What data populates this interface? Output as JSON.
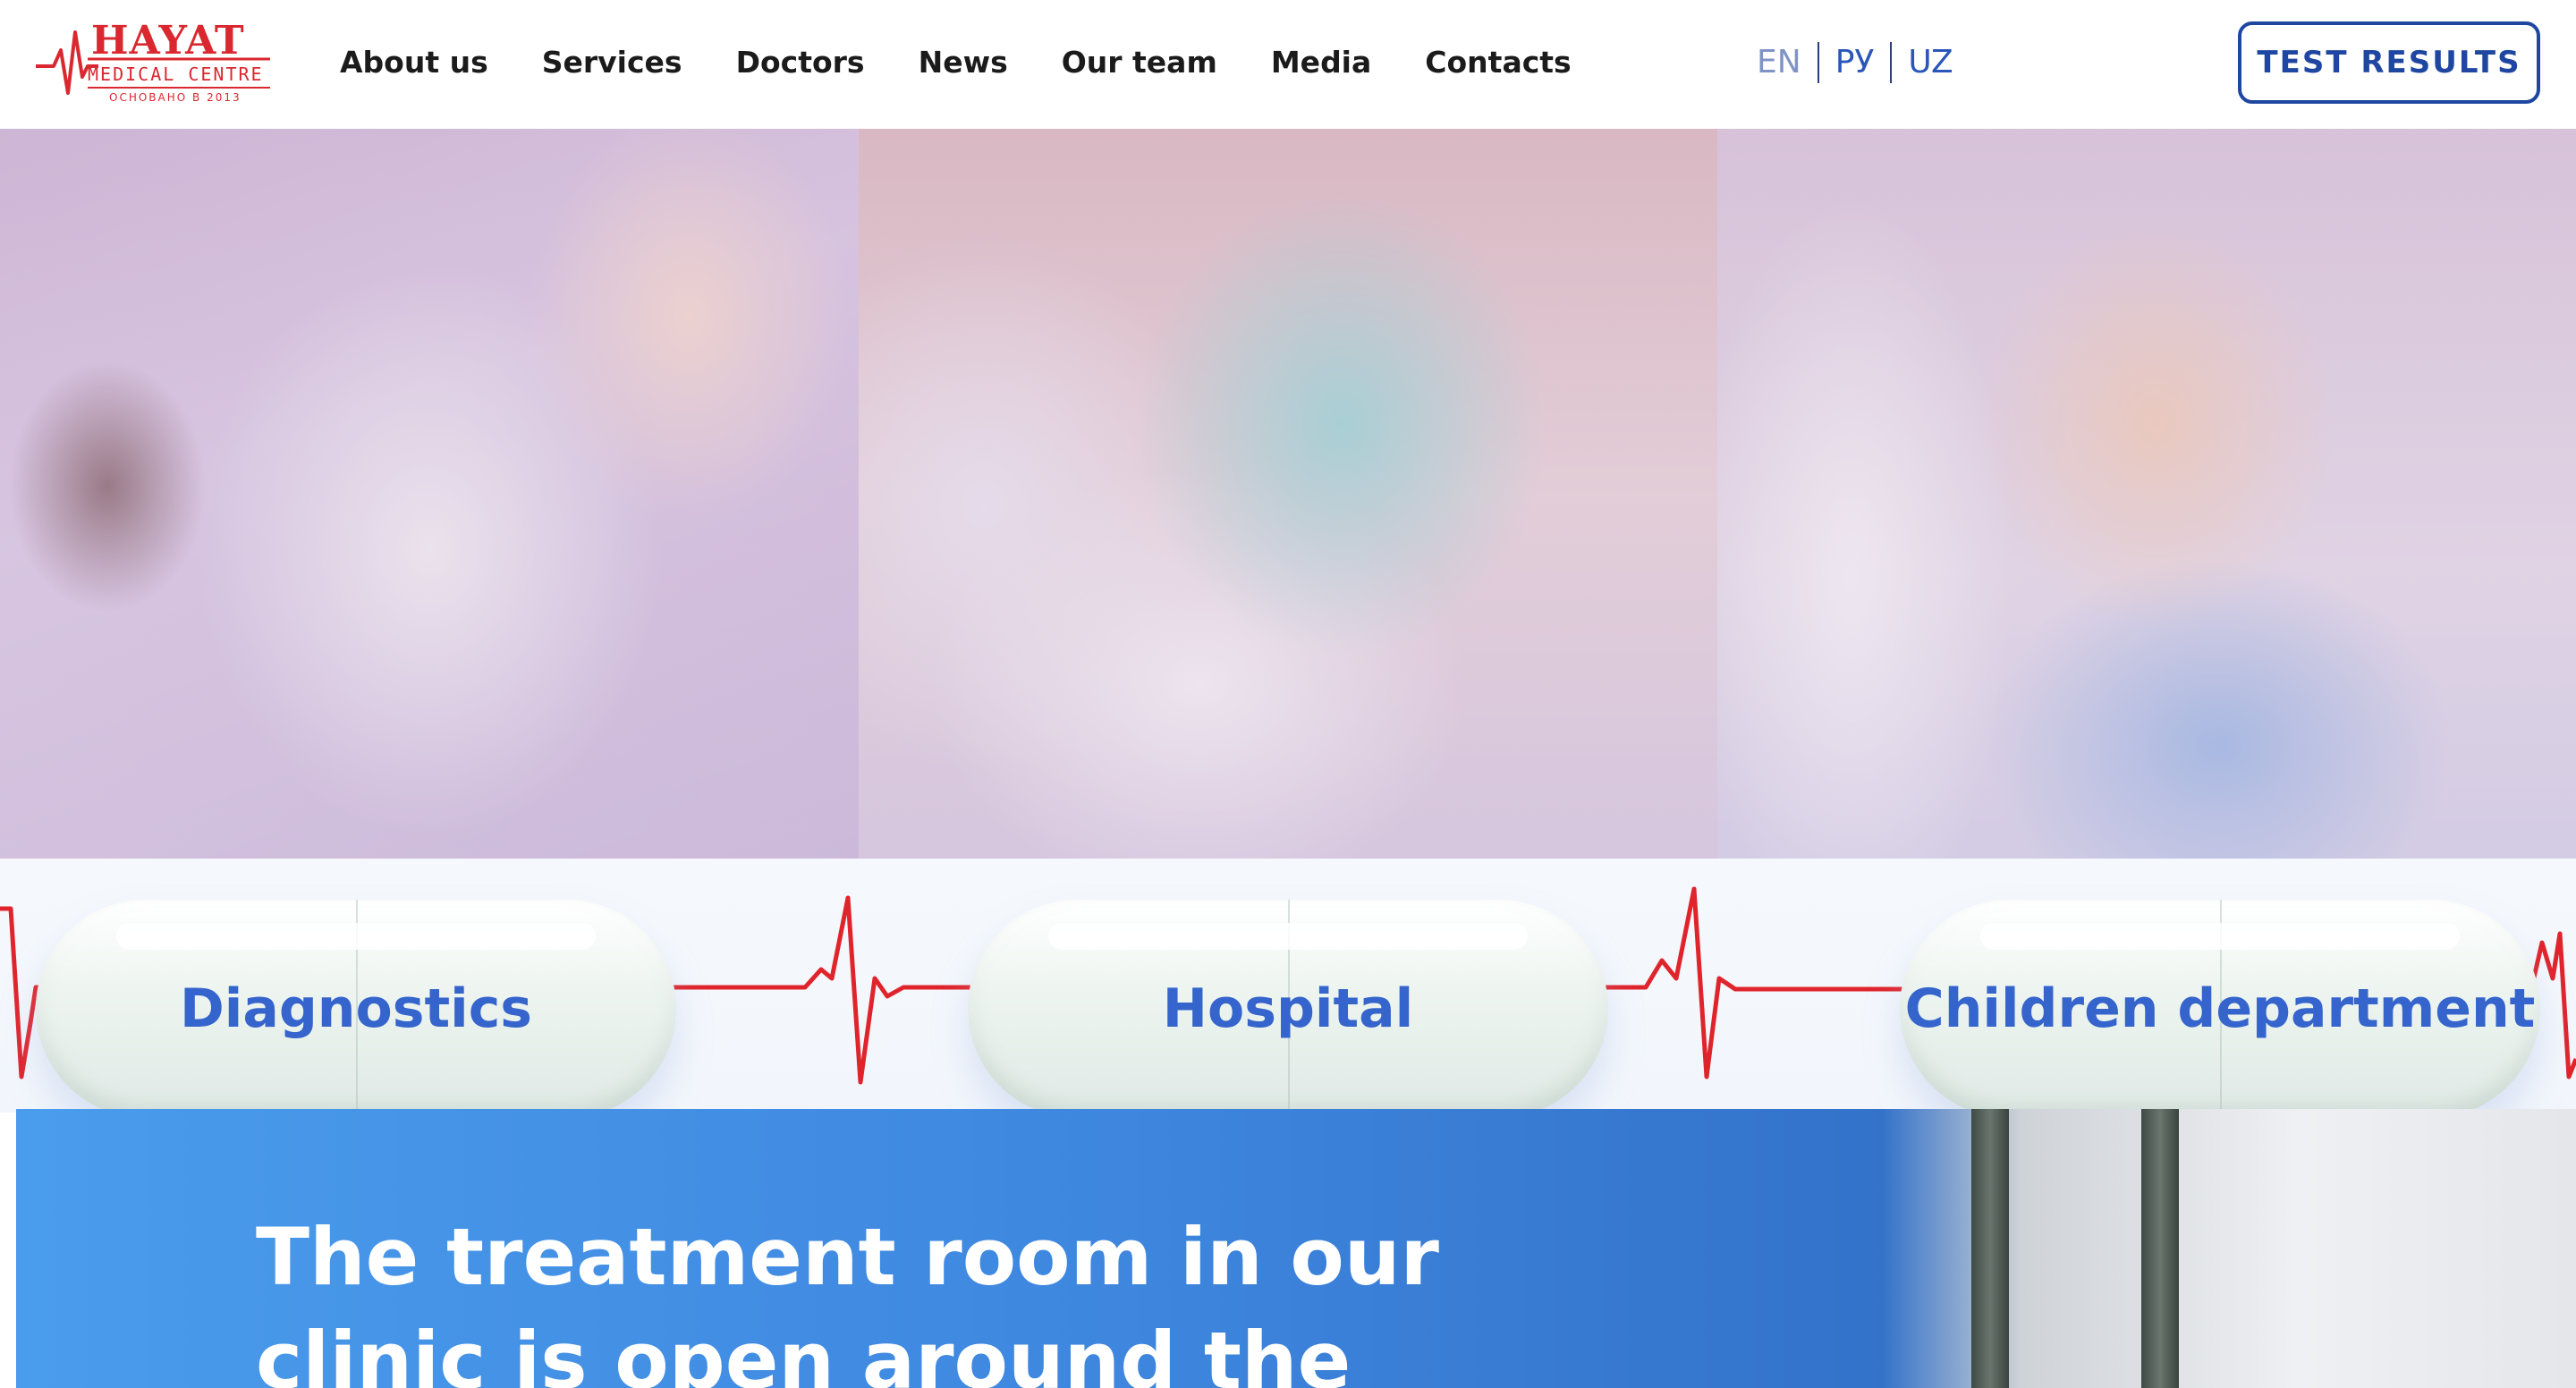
{
  "header": {
    "logo": {
      "name": "HAYAT",
      "subtitle": "MEDICAL CENTRE",
      "founded": "ОСНОВАНО В 2013",
      "accent_color": "#d9282f"
    },
    "nav": {
      "items": [
        {
          "label": "About us"
        },
        {
          "label": "Services"
        },
        {
          "label": "Doctors"
        },
        {
          "label": "News"
        },
        {
          "label": "Our team"
        },
        {
          "label": "Media"
        },
        {
          "label": "Contacts"
        }
      ]
    },
    "languages": [
      {
        "label": "EN",
        "active": true
      },
      {
        "label": "РУ",
        "active": false
      },
      {
        "label": "UZ",
        "active": false
      }
    ],
    "test_results_label": "TEST RESULTS",
    "brand_color": "#1f47a1"
  },
  "hero": {
    "panels": [
      {
        "image": "laboratory-microscope-photo",
        "label": "Diagnostics"
      },
      {
        "image": "hospital-patient-photo",
        "label": "Hospital"
      },
      {
        "image": "doctor-with-baby-photo",
        "label": "Children department"
      }
    ],
    "heartbeat_color": "#e0242c",
    "label_color": "#3464cc"
  },
  "banner": {
    "title": "The treatment room in our clinic is open around the",
    "gradient_start": "#4a9cec",
    "gradient_end": "#2f64b6"
  }
}
